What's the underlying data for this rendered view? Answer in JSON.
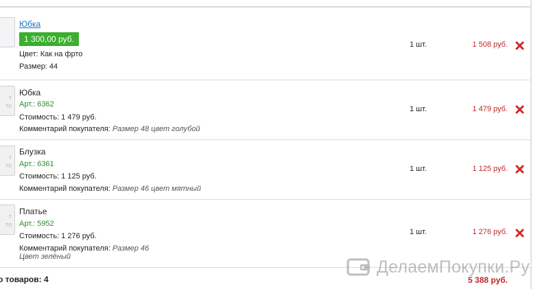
{
  "items": [
    {
      "name": "Юбка",
      "price_badge": "1 300,00 руб.",
      "line1": "Цвет: Как на фрто",
      "line2": "Размер: 44",
      "qty": "1 шт.",
      "sum": "1 508 руб."
    },
    {
      "name": "Юбка",
      "thumb_text": "т\nто",
      "art": "Арт.: 6362",
      "cost": "Стоимость: 1 479 руб.",
      "comment_label": "Комментарий покупателя:",
      "comment": "Размер 48 цвет голубой",
      "qty": "1 шт.",
      "sum": "1 479 руб."
    },
    {
      "name": "Блузка",
      "thumb_text": "т\nто",
      "art": "Арт.: 6361",
      "cost": "Стоимость: 1 125 руб.",
      "comment_label": "Комментарий покупателя:",
      "comment": "Размер 46 цвет мятный",
      "qty": "1 шт.",
      "sum": "1 125 руб."
    },
    {
      "name": "Платье",
      "thumb_text": "т\nто",
      "art": "Арт.: 5952",
      "cost": "Стоимость: 1 276 руб.",
      "comment_label": "Комментарий покупателя:",
      "comment": "Размер 46",
      "comment2": "Цвет зелёный",
      "qty": "1 шт.",
      "sum": "1 276 руб."
    }
  ],
  "total": {
    "label": "о товаров: 4",
    "sum": "5 388 руб."
  },
  "watermark": "ДелаемПокупки.Ру",
  "colors": {
    "accent_green": "#3aae2d",
    "price_red": "#c0262b",
    "link_blue": "#1a73c4",
    "delete_red": "#d0282c"
  },
  "icons": {
    "delete": "close-x-icon",
    "watermark_logo": "wallet-icon"
  }
}
